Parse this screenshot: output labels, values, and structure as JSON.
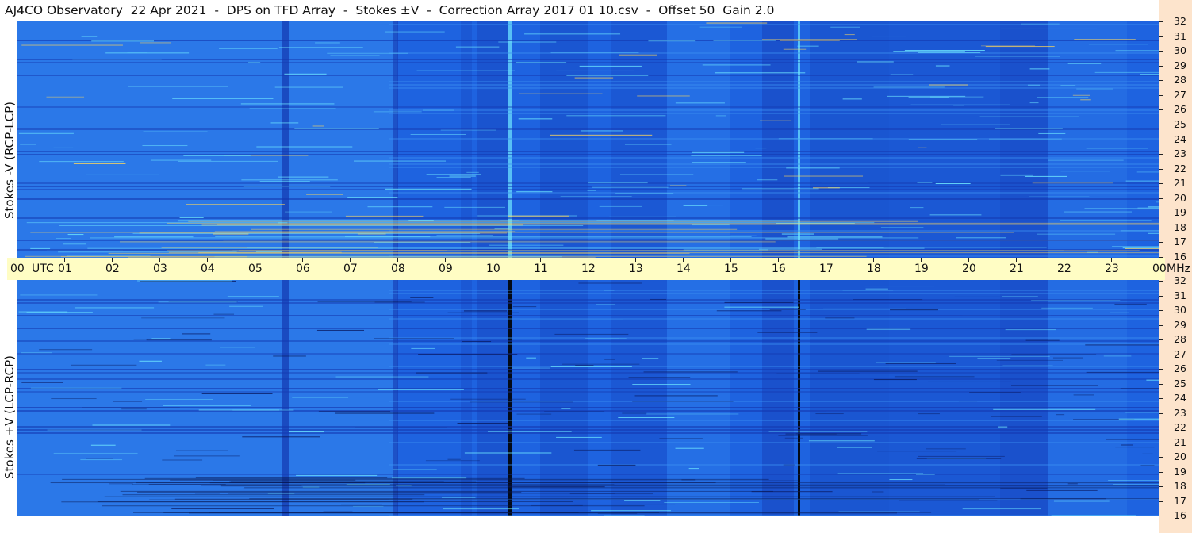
{
  "title": "AJ4CO Observatory  22 Apr 2021  -  DPS on TFD Array  -  Stokes ±V  -  Correction Array 2017 01 10.csv  -  Offset 50  Gain 2.0",
  "panels": {
    "top": {
      "label": "Stokes -V (RCP-LCP)"
    },
    "bottom": {
      "label": "Stokes +V (LCP-RCP)"
    }
  },
  "time_axis": {
    "labels": [
      "00",
      "01",
      "02",
      "03",
      "04",
      "05",
      "06",
      "07",
      "08",
      "09",
      "10",
      "11",
      "12",
      "13",
      "14",
      "15",
      "16",
      "17",
      "18",
      "19",
      "20",
      "21",
      "22",
      "23",
      "00"
    ],
    "unit_label": "UTC",
    "freq_unit": "MHz"
  },
  "freq_axis": {
    "labels": [
      "32",
      "31",
      "30",
      "29",
      "28",
      "27",
      "26",
      "25",
      "24",
      "23",
      "22",
      "21",
      "20",
      "19",
      "18",
      "17",
      "16"
    ]
  },
  "colors": {
    "background": "#1e63e0",
    "dark_band": "#1438b0",
    "bright_band": "#3b92f2",
    "highlight": "#6fe8ff",
    "hot": "#ffd75a",
    "freq_strip": "#fde4cc",
    "time_strip": "#fffdc4"
  }
}
